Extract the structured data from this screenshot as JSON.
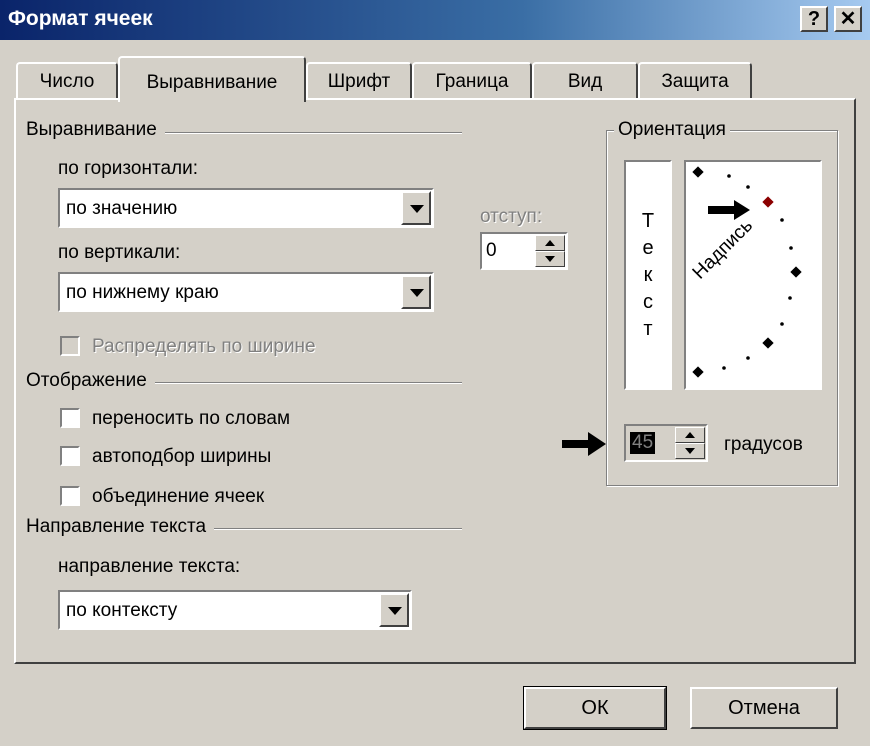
{
  "window": {
    "title": "Формат ячеек",
    "help_label": "?",
    "close_label": "✕"
  },
  "tabs": [
    {
      "label": "Число"
    },
    {
      "label": "Выравнивание",
      "active": true
    },
    {
      "label": "Шрифт"
    },
    {
      "label": "Граница"
    },
    {
      "label": "Вид"
    },
    {
      "label": "Защита"
    }
  ],
  "alignment": {
    "group_title": "Выравнивание",
    "horizontal_label": "по горизонтали:",
    "horizontal_value": "по значению",
    "vertical_label": "по вертикали:",
    "vertical_value": "по нижнему краю",
    "distribute_label": "Распределять по ширине",
    "indent_label": "отступ:",
    "indent_value": "0"
  },
  "display": {
    "group_title": "Отображение",
    "wrap_label": "переносить по словам",
    "shrink_label": "автоподбор ширины",
    "merge_label": "объединение ячеек"
  },
  "direction": {
    "group_title": "Направление текста",
    "label": "направление текста:",
    "value": "по контексту"
  },
  "orientation": {
    "group_title": "Ориентация",
    "vertical_text": [
      "Т",
      "е",
      "к",
      "с",
      "т"
    ],
    "rotated_text": "Надпись",
    "angle_value": "45",
    "degrees_label": "градусов"
  },
  "buttons": {
    "ok": "ОК",
    "cancel": "Отмена"
  }
}
